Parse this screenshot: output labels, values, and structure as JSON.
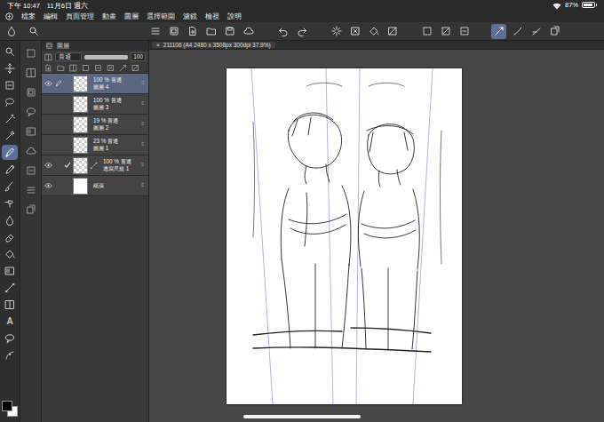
{
  "status_bar": {
    "time": "下午 10:47",
    "date": "11月6日 週六",
    "battery": "87%",
    "battery_level": 0.87
  },
  "menu": [
    "檔案",
    "編輯",
    "頁面管理",
    "動畫",
    "圖層",
    "選擇範圍",
    "濾鏡",
    "檢視",
    "說明"
  ],
  "toolbar": [
    {
      "kind": "menu",
      "selected": false
    },
    {
      "kind": "layer-mode",
      "selected": false
    },
    {
      "kind": "new-doc",
      "selected": false
    },
    {
      "kind": "open",
      "selected": false
    },
    {
      "kind": "save",
      "selected": false
    },
    {
      "kind": "cloud",
      "selected": false
    },
    {
      "kind": "undo",
      "selected": false
    },
    {
      "kind": "redo",
      "selected": false
    },
    {
      "kind": "sparkle",
      "selected": false
    },
    {
      "kind": "clear",
      "selected": false
    },
    {
      "kind": "fill",
      "selected": false
    },
    {
      "kind": "invert",
      "selected": false
    },
    {
      "kind": "select",
      "selected": false
    },
    {
      "kind": "select-off",
      "selected": false
    },
    {
      "kind": "transform",
      "selected": false
    },
    {
      "kind": "stroke",
      "selected": true
    },
    {
      "kind": "stroke2",
      "selected": false
    },
    {
      "kind": "stroke3",
      "selected": false
    },
    {
      "kind": "share",
      "selected": false
    }
  ],
  "tools": [
    {
      "kind": "zoom",
      "selected": false
    },
    {
      "kind": "move",
      "selected": false
    },
    {
      "kind": "transform",
      "selected": false
    },
    {
      "kind": "lasso",
      "selected": false
    },
    {
      "kind": "wand",
      "selected": false
    },
    {
      "kind": "eyedropper",
      "selected": false
    },
    {
      "kind": "pen",
      "selected": true
    },
    {
      "kind": "pencil",
      "selected": false
    },
    {
      "kind": "brush",
      "selected": false
    },
    {
      "kind": "airbrush",
      "selected": false
    },
    {
      "kind": "blend",
      "selected": false
    },
    {
      "kind": "eraser",
      "selected": false
    },
    {
      "kind": "fill",
      "selected": false
    },
    {
      "kind": "gradient",
      "selected": false
    },
    {
      "kind": "figure",
      "selected": false
    },
    {
      "kind": "frame",
      "selected": false
    },
    {
      "kind": "text",
      "glyph": "A",
      "selected": false
    },
    {
      "kind": "balloon",
      "selected": false
    },
    {
      "kind": "correct",
      "selected": false
    }
  ],
  "colors": [
    {
      "role": "main",
      "color": "#000000"
    },
    {
      "role": "sub",
      "color": "#ffffff"
    }
  ],
  "layer_panel": {
    "title": "圖層",
    "blend_mode": "普通",
    "opacity": "100",
    "opacity_level": 1,
    "layers": [
      {
        "info": "100 % 普通",
        "name": "圖層 4",
        "kind": "raster",
        "selected": true,
        "visible": true,
        "editing": true
      },
      {
        "info": "100 % 普通",
        "name": "圖層 3",
        "kind": "raster",
        "selected": false,
        "visible": false,
        "editing": false
      },
      {
        "info": "19 % 普通",
        "name": "圖層 2",
        "kind": "raster",
        "selected": false,
        "visible": false,
        "editing": false
      },
      {
        "info": "23 % 普通",
        "name": "圖層 1",
        "kind": "raster",
        "selected": false,
        "visible": false,
        "editing": false
      },
      {
        "info": "100 % 普通",
        "name": "透寫尺規 1",
        "kind": "ruler",
        "selected": false,
        "visible": true,
        "editing": false
      },
      {
        "info": "",
        "name": "紙張",
        "kind": "paper",
        "selected": false,
        "visible": true,
        "editing": false
      }
    ]
  },
  "document": {
    "close": "×",
    "tab_title": "211106 (A4 2480 x 3508px 300dpi 37.9%)"
  }
}
